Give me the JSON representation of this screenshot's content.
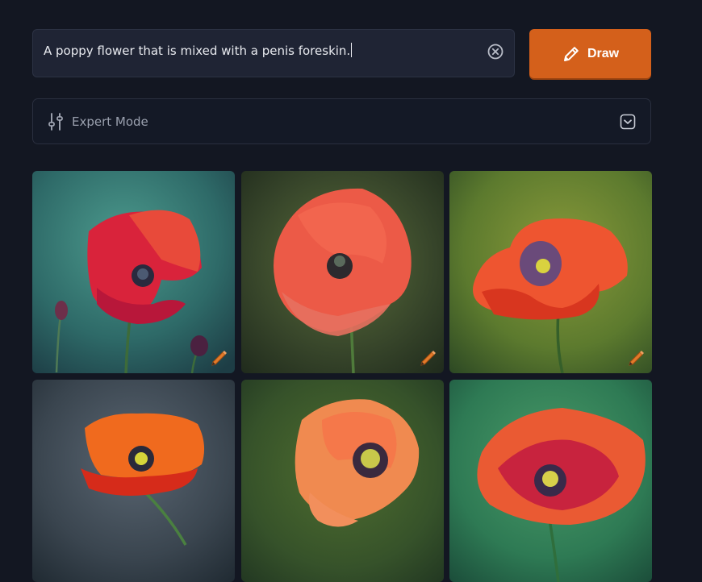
{
  "prompt": {
    "value": "A poppy flower that is mixed with a penis foreskin.",
    "clear_icon": "x-circle-icon"
  },
  "draw_button": {
    "label": "Draw",
    "icon": "pencil-icon",
    "color": "#d4601b"
  },
  "expert_mode": {
    "label": "Expert Mode",
    "icon": "sliders-icon",
    "toggle_icon": "chevron-down-icon"
  },
  "results": [
    {
      "name": "image-1",
      "badge_icon": "pencil-icon"
    },
    {
      "name": "image-2",
      "badge_icon": "pencil-icon"
    },
    {
      "name": "image-3",
      "badge_icon": "pencil-icon"
    },
    {
      "name": "image-4"
    },
    {
      "name": "image-5"
    },
    {
      "name": "image-6"
    }
  ],
  "colors": {
    "background": "#131722",
    "input_bg": "#1f2434",
    "accent": "#d4601b"
  }
}
